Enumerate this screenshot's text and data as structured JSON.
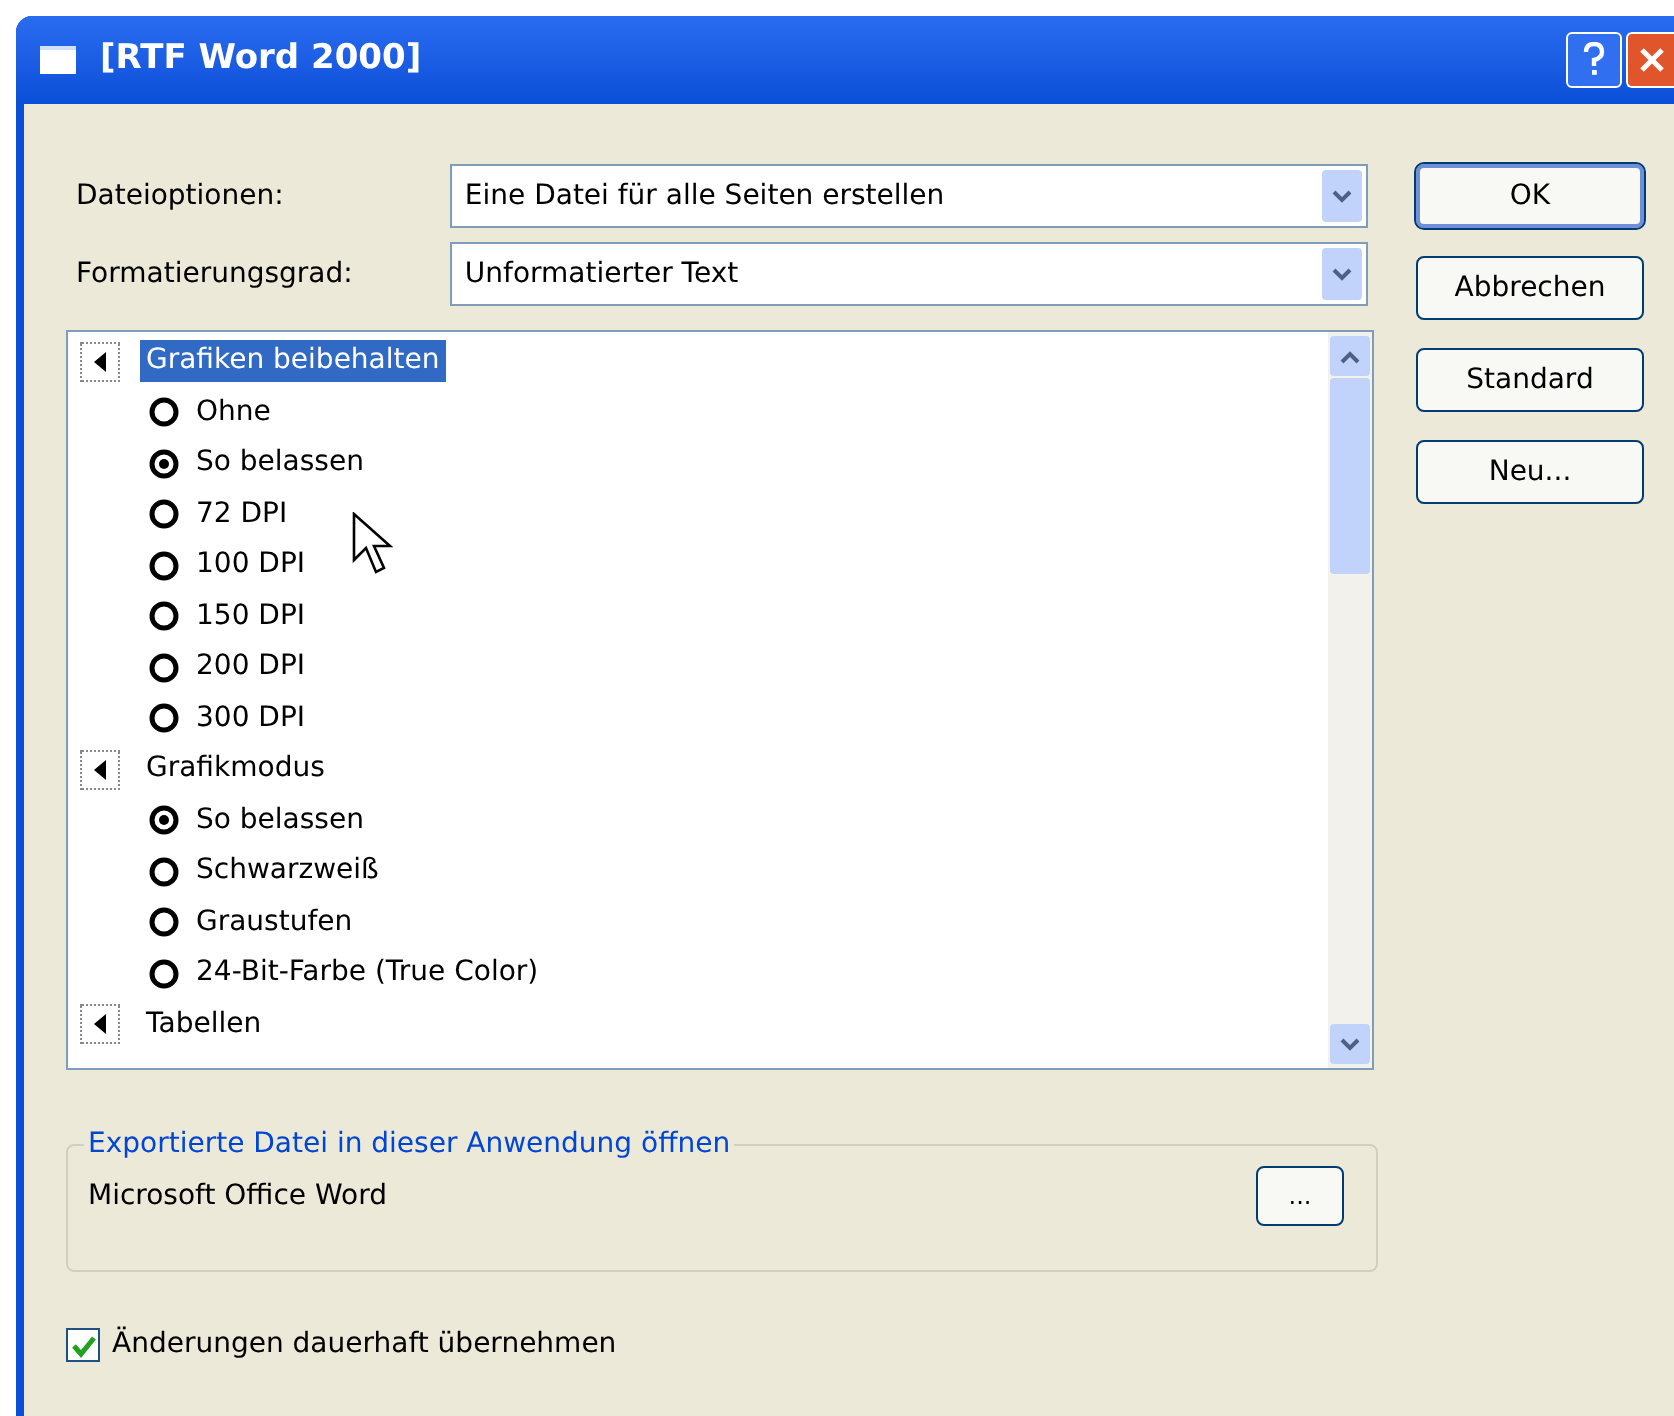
{
  "window": {
    "title": "[RTF Word 2000]"
  },
  "fields": [
    {
      "label": "Dateioptionen:",
      "value": "Eine Datei für alle Seiten erstellen"
    },
    {
      "label": "Formatierungsgrad:",
      "value": "Unformatierter Text"
    }
  ],
  "buttons": [
    "OK",
    "Abbrechen",
    "Standard",
    "Neu..."
  ],
  "tree": [
    {
      "label": "Grafiken beibehalten",
      "selected": true,
      "children": [
        {
          "label": "Ohne",
          "checked": false
        },
        {
          "label": "So belassen",
          "checked": true
        },
        {
          "label": "72 DPI",
          "checked": false
        },
        {
          "label": "100 DPI",
          "checked": false
        },
        {
          "label": "150 DPI",
          "checked": false
        },
        {
          "label": "200 DPI",
          "checked": false
        },
        {
          "label": "300 DPI",
          "checked": false
        }
      ]
    },
    {
      "label": "Grafikmodus",
      "selected": false,
      "children": [
        {
          "label": "So belassen",
          "checked": true
        },
        {
          "label": "Schwarzweiß",
          "checked": false
        },
        {
          "label": "Graustufen",
          "checked": false
        },
        {
          "label": "24-Bit-Farbe (True Color)",
          "checked": false
        }
      ]
    },
    {
      "label": "Tabellen",
      "selected": false
    }
  ],
  "open_with": {
    "title": "Exportierte Datei in dieser Anwendung öffnen",
    "app": "Microsoft Office Word",
    "browse": "..."
  },
  "persist": {
    "label": "Änderungen dauerhaft übernehmen",
    "checked": true
  }
}
